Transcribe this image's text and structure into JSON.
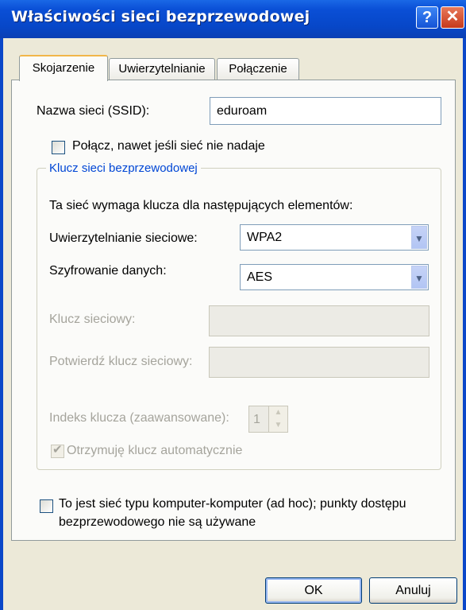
{
  "window": {
    "title": "Właściwości sieci bezprzewodowej",
    "help_glyph": "?",
    "close_glyph": "✕"
  },
  "tabs": [
    {
      "label": "Skojarzenie"
    },
    {
      "label": "Uwierzytelnianie"
    },
    {
      "label": "Połączenie"
    }
  ],
  "association": {
    "ssid_label": "Nazwa sieci (SSID):",
    "ssid_value": "eduroam",
    "connect_even_label": "Połącz, nawet jeśli sieć nie nadaje",
    "group_title": "Klucz sieci bezprzewodowej",
    "requirement_text": "Ta sieć wymaga klucza dla następujących elementów:",
    "auth_label": "Uwierzytelnianie sieciowe:",
    "auth_value": "WPA2",
    "encryption_label": "Szyfrowanie danych:",
    "encryption_value": "AES",
    "key_label": "Klucz sieciowy:",
    "confirm_key_label": "Potwierdź klucz sieciowy:",
    "key_index_label": "Indeks klucza (zaawansowane):",
    "key_index_value": "1",
    "auto_key_label": "Otrzymuję klucz automatycznie",
    "adhoc_label_line1": "To jest sieć typu komputer-komputer (ad hoc); punkty dostępu",
    "adhoc_label_line2": "bezprzewodowego nie są używane"
  },
  "buttons": {
    "ok": "OK",
    "cancel": "Anuluj"
  }
}
